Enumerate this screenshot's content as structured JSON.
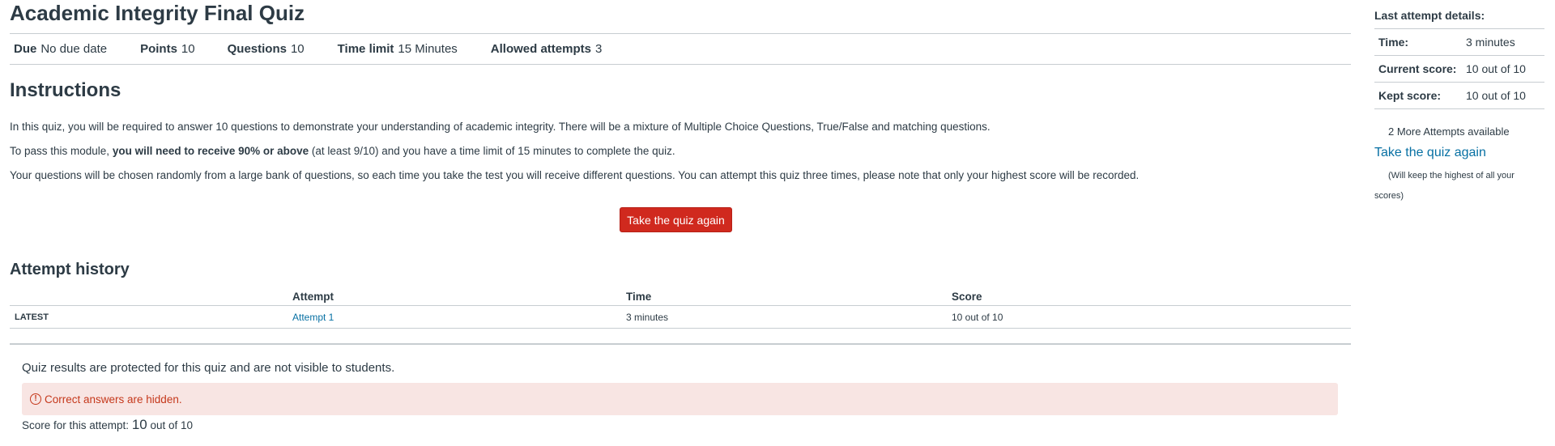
{
  "quiz": {
    "title": "Academic Integrity Final Quiz"
  },
  "details": {
    "due_label": "Due",
    "due_value": "No due date",
    "points_label": "Points",
    "points_value": "10",
    "questions_label": "Questions",
    "questions_value": "10",
    "time_limit_label": "Time limit",
    "time_limit_value": "15 Minutes",
    "allowed_attempts_label": "Allowed attempts",
    "allowed_attempts_value": "3"
  },
  "instructions": {
    "heading": "Instructions",
    "p1": "In this quiz, you will be required to answer 10 questions to demonstrate your understanding of academic integrity. There will be a mixture of Multiple Choice Questions, True/False and matching questions.",
    "p2_before": "To pass this module, ",
    "p2_bold": "you will need to receive 90% or above",
    "p2_after": " (at least 9/10) and you have a time limit of 15 minutes to complete the quiz.",
    "p3": "Your questions will be chosen randomly from a large bank of questions, so each time you take the test you will receive different questions. You can attempt this quiz three times, please note that only your highest score will be recorded."
  },
  "take_quiz_button": "Take the quiz again",
  "attempt_history": {
    "heading": "Attempt history",
    "columns": [
      "Attempt",
      "Time",
      "Score"
    ],
    "rows": [
      {
        "tag": "LATEST",
        "attempt": "Attempt 1",
        "time": "3 minutes",
        "score": "10 out of 10"
      }
    ]
  },
  "results": {
    "protected_message": "Quiz results are protected for this quiz and are not visible to students.",
    "alert_icon": "alert-circle-icon",
    "alert_text": "Correct answers are hidden.",
    "score_prefix": "Score for this attempt: ",
    "score_value": "10",
    "score_suffix": " out of 10"
  },
  "sidebar": {
    "heading": "Last attempt details:",
    "rows": [
      {
        "label": "Time:",
        "value": "3 minutes"
      },
      {
        "label": "Current score:",
        "value": "10 out of 10"
      },
      {
        "label": "Kept score:",
        "value": "10 out of 10"
      }
    ],
    "more_attempts": "2 More Attempts available",
    "take_link": "Take the quiz again",
    "note": "(Will keep the highest of all your scores)"
  },
  "colors": {
    "primary_button": "#d0291e",
    "link": "#0770a3",
    "alert_bg": "#f8e5e3",
    "alert_text": "#c5381b"
  }
}
